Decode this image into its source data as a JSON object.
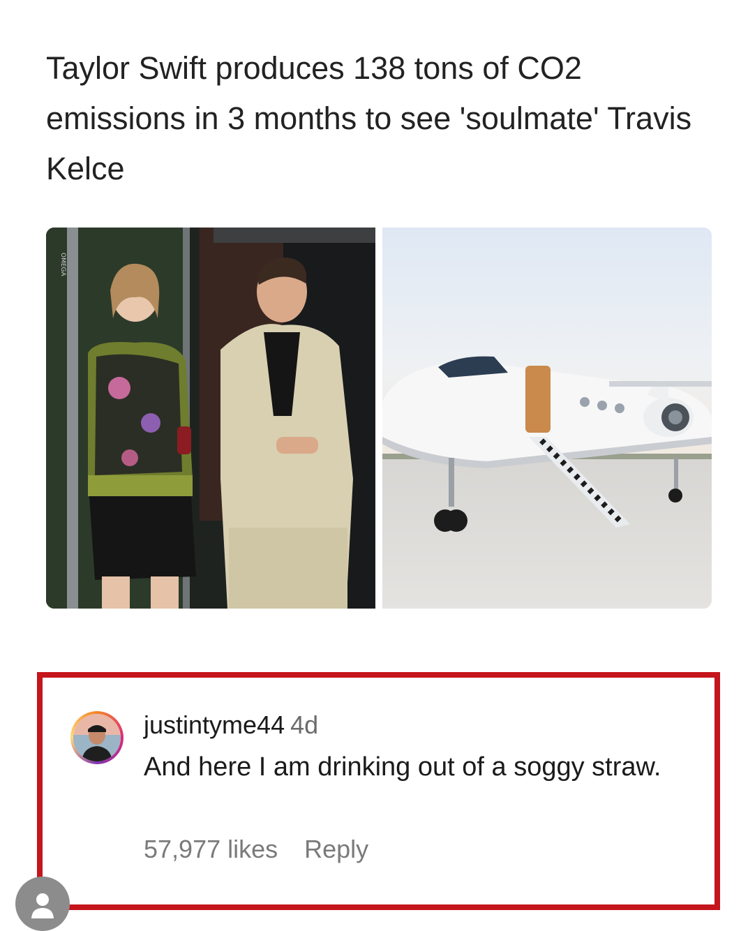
{
  "post": {
    "headline": "Taylor Swift produces 138 tons of CO2 emissions in 3 months to see 'soulmate' Travis Kelce",
    "photo_left_watermark": "OMEGA"
  },
  "comment": {
    "username": "justintyme44",
    "time_ago": "4d",
    "text": "And here I am drinking out of a soggy straw.",
    "likes": "57,977 likes",
    "reply_label": "Reply",
    "highlight_color": "#c4161c"
  },
  "icons": {
    "avatar": "profile-photo",
    "floating_button": "user-icon"
  }
}
